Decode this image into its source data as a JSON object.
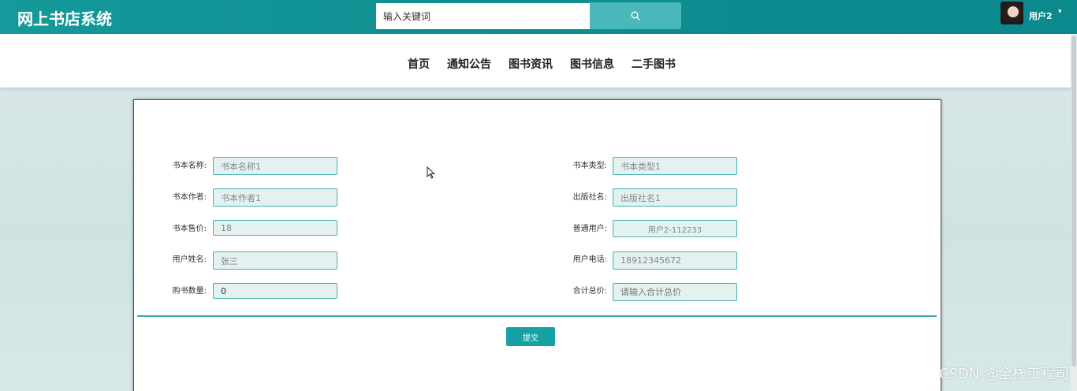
{
  "header": {
    "brand": "网上书店系统",
    "search_placeholder": "输入关键词",
    "search_icon": "search-icon",
    "user_name": "用户2",
    "user_caret": "▾"
  },
  "nav": {
    "items": [
      "首页",
      "通知公告",
      "图书资讯",
      "图书信息",
      "二手图书"
    ]
  },
  "form": {
    "left": [
      {
        "label": "书本名称:",
        "value": "书本名称1"
      },
      {
        "label": "书本作者:",
        "value": "书本作者1"
      },
      {
        "label": "书本售价:",
        "value": "18"
      },
      {
        "label": "用户姓名:",
        "value": "张三"
      },
      {
        "label": "购书数量:",
        "value": "0"
      }
    ],
    "right": [
      {
        "label": "书本类型:",
        "value": "书本类型1"
      },
      {
        "label": "出版社名:",
        "value": "出版社名1"
      },
      {
        "label": "普通用户:",
        "value": "用户2-112233"
      },
      {
        "label": "用户电话:",
        "value": "18912345672"
      },
      {
        "label": "合计总价:",
        "value": "",
        "placeholder": "请输入合计总价"
      }
    ],
    "submit_label": "提交"
  },
  "watermark": "CSDN @全栈工程司",
  "colors": {
    "header_bg": "#0d8e90",
    "search_button": "#4ab8ba",
    "field_border": "#45b2b4",
    "field_bg": "#e4f1f1",
    "submit_bg": "#16a2a4"
  }
}
